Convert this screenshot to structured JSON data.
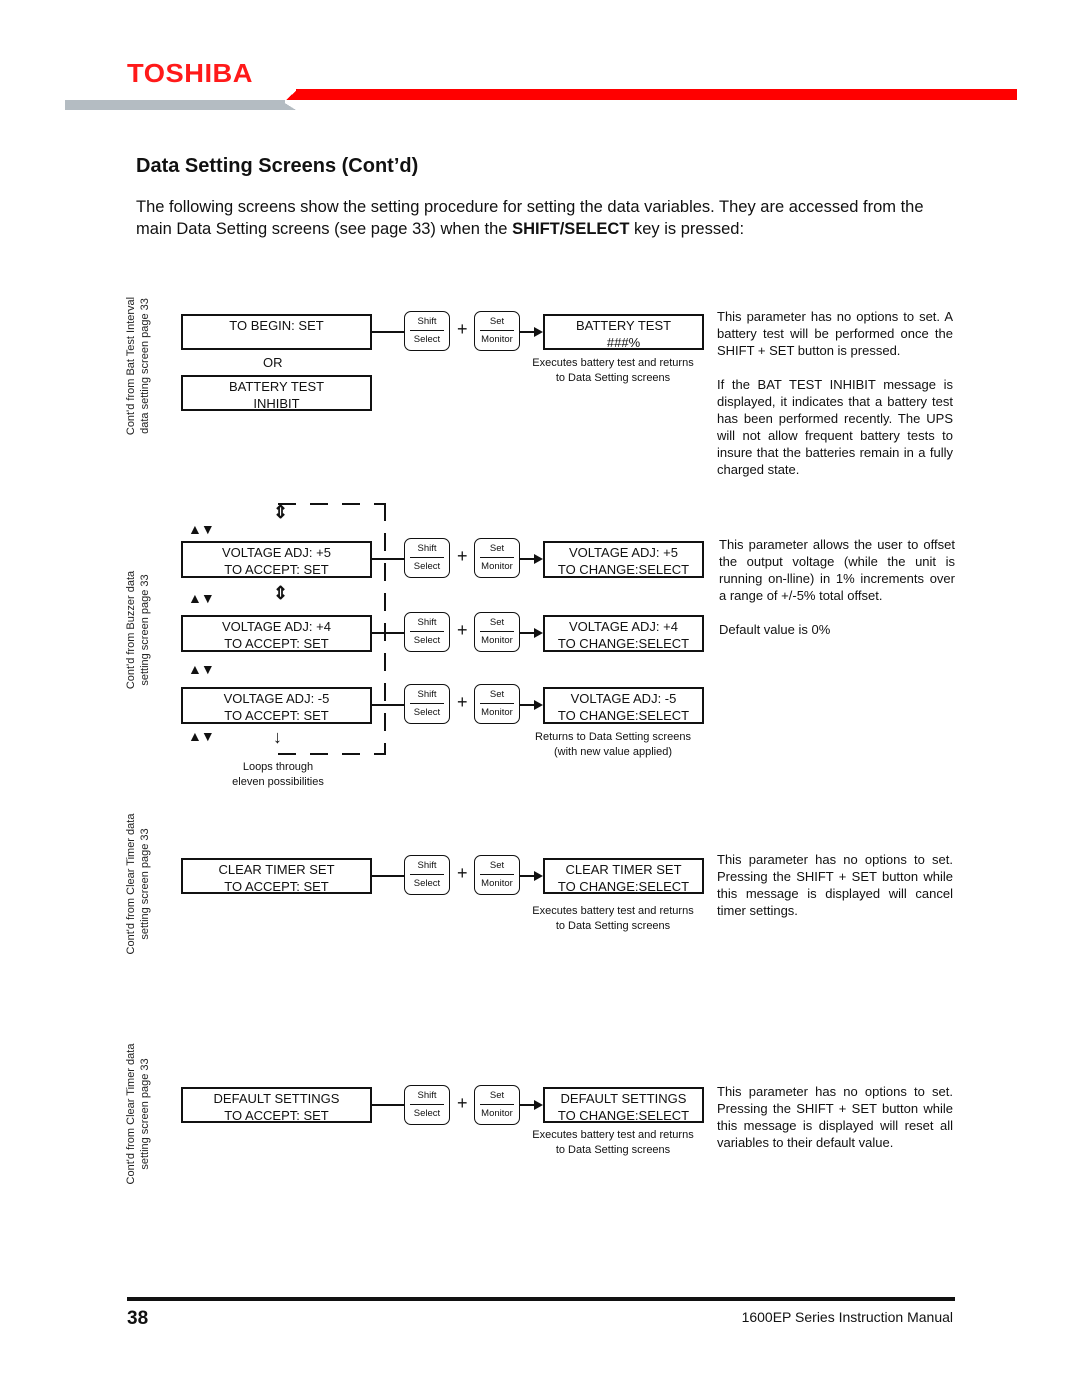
{
  "header": {
    "brand": "TOSHIBA",
    "colors": {
      "brand_red": "#ff0000",
      "band_gray": "#b4bcc2"
    }
  },
  "page": {
    "title": "Data Setting Screens (Cont’d)",
    "intro_part1": "The following screens show the setting procedure for setting the data variables. They are accessed from the main Data Setting screens (see page 33) when the ",
    "intro_bold": "SHIFT/SELECT",
    "intro_part2": " key is pressed:"
  },
  "keys": {
    "shift_top": "Shift",
    "shift_bottom": "Select",
    "set_top": "Set",
    "set_bottom": "Monitor",
    "plus": "+"
  },
  "sections": {
    "battery": {
      "side_line1": "Cont'd from Bat Test Interval",
      "side_line2": "data setting screen page 33",
      "lcd1_line1": "TO BEGIN: SET",
      "lcd1_line2": "",
      "or_label": "OR",
      "lcd2_line1": "BATTERY TEST",
      "lcd2_line2": "INHIBIT",
      "result_line1": "BATTERY TEST",
      "result_line2": "###%",
      "note_line1": "Executes battery test and returns",
      "note_line2": "to Data Setting screens",
      "desc1": "This parameter has no options to set. A battery test will be performed once the SHIFT + SET button is pressed.",
      "desc2": "If the BAT TEST INHIBIT message is displayed, it indicates that a battery test has been performed recently. The UPS will not allow frequent battery tests to insure that the batteries remain in a fully charged state."
    },
    "voltage": {
      "side_line1": "Cont'd from Buzzer data",
      "side_line2": "setting screen page 33",
      "rows": [
        {
          "accept_line1": "VOLTAGE ADJ: +5",
          "accept_line2": "TO ACCEPT: SET",
          "change_line1": "VOLTAGE ADJ: +5",
          "change_line2": "TO CHANGE:SELECT"
        },
        {
          "accept_line1": "VOLTAGE ADJ: +4",
          "accept_line2": "TO ACCEPT: SET",
          "change_line1": "VOLTAGE ADJ: +4",
          "change_line2": "TO CHANGE:SELECT"
        },
        {
          "accept_line1": "VOLTAGE ADJ: -5",
          "accept_line2": "TO ACCEPT: SET",
          "change_line1": "VOLTAGE ADJ: -5",
          "change_line2": "TO CHANGE:SELECT"
        }
      ],
      "updown_glyph": "▲▼",
      "loop_note_line1": "Loops through",
      "loop_note_line2": "eleven possibilities",
      "return_note_line1": "Returns to Data Setting screens",
      "return_note_line2": "(with new value applied)",
      "desc1": "This parameter allows the user to offset the output voltage (while the unit is running on-lline) in 1% increments over a range of +/-5% total offset.",
      "desc2": "Default value is 0%"
    },
    "clear_timer": {
      "side_line1": "Cont'd from Clear Timer data",
      "side_line2": "setting screen page 33",
      "lcd_line1": "CLEAR TIMER SET",
      "lcd_line2": "TO ACCEPT: SET",
      "result_line1": "CLEAR TIMER SET",
      "result_line2": "TO CHANGE:SELECT",
      "note_line1": "Executes battery test and returns",
      "note_line2": "to Data Setting screens",
      "desc": "This parameter has no options to set. Pressing the SHIFT + SET button while this message is displayed will cancel timer settings."
    },
    "defaults": {
      "side_line1": "Cont'd from Clear Timer data",
      "side_line2": "setting screen page 33",
      "lcd_line1": "DEFAULT SETTINGS",
      "lcd_line2": "TO ACCEPT: SET",
      "result_line1": "DEFAULT SETTINGS",
      "result_line2": "TO CHANGE:SELECT",
      "note_line1": "Executes battery test and returns",
      "note_line2": "to Data Setting screens",
      "desc": "This parameter has no options to set.  Pressing the SHIFT + SET button while this message is displayed will reset all variables to their default value."
    }
  },
  "footer": {
    "page_number": "38",
    "manual_title": "1600EP Series Instruction Manual"
  }
}
